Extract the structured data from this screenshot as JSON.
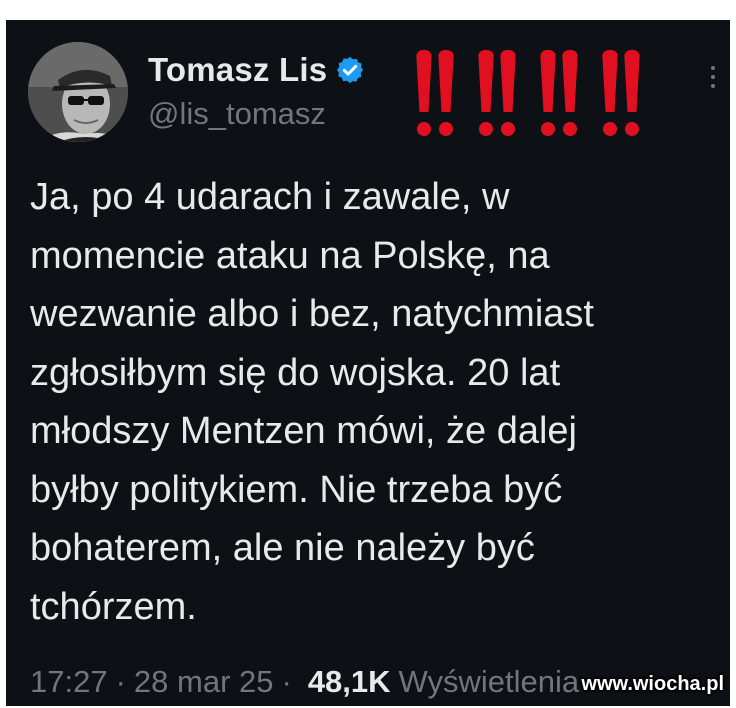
{
  "post": {
    "author": {
      "display_name": "Tomasz Lis",
      "handle": "@lis_tomasz",
      "verified_icon": "verified-badge-icon",
      "avatar_icon": "avatar-photo"
    },
    "overlay_marks": "!! !! !! !!",
    "overlay_color": "#e01020",
    "more_icon": "more-vertical-icon",
    "text": "Ja, po 4 udarach i zawale, w\nmomencie ataku na Polskę, na\nwezwanie albo i bez, natychmiast\nzgłosiłbym się do wojska. 20 lat\nmłodszy Mentzen mówi, że dalej\nbyłby politykiem. Nie trzeba być\nbohaterem, ale nie należy być\ntchórzem.",
    "time": "17:27",
    "separator": "·",
    "date": "28 mar 25",
    "views_count": "48,1K",
    "views_label": "Wyświetlenia"
  },
  "watermark": "www.wiocha.pl",
  "colors": {
    "background": "#0d1014",
    "text_primary": "#e7e9ea",
    "text_secondary": "#71767b",
    "verified_blue": "#1d9bf0"
  }
}
